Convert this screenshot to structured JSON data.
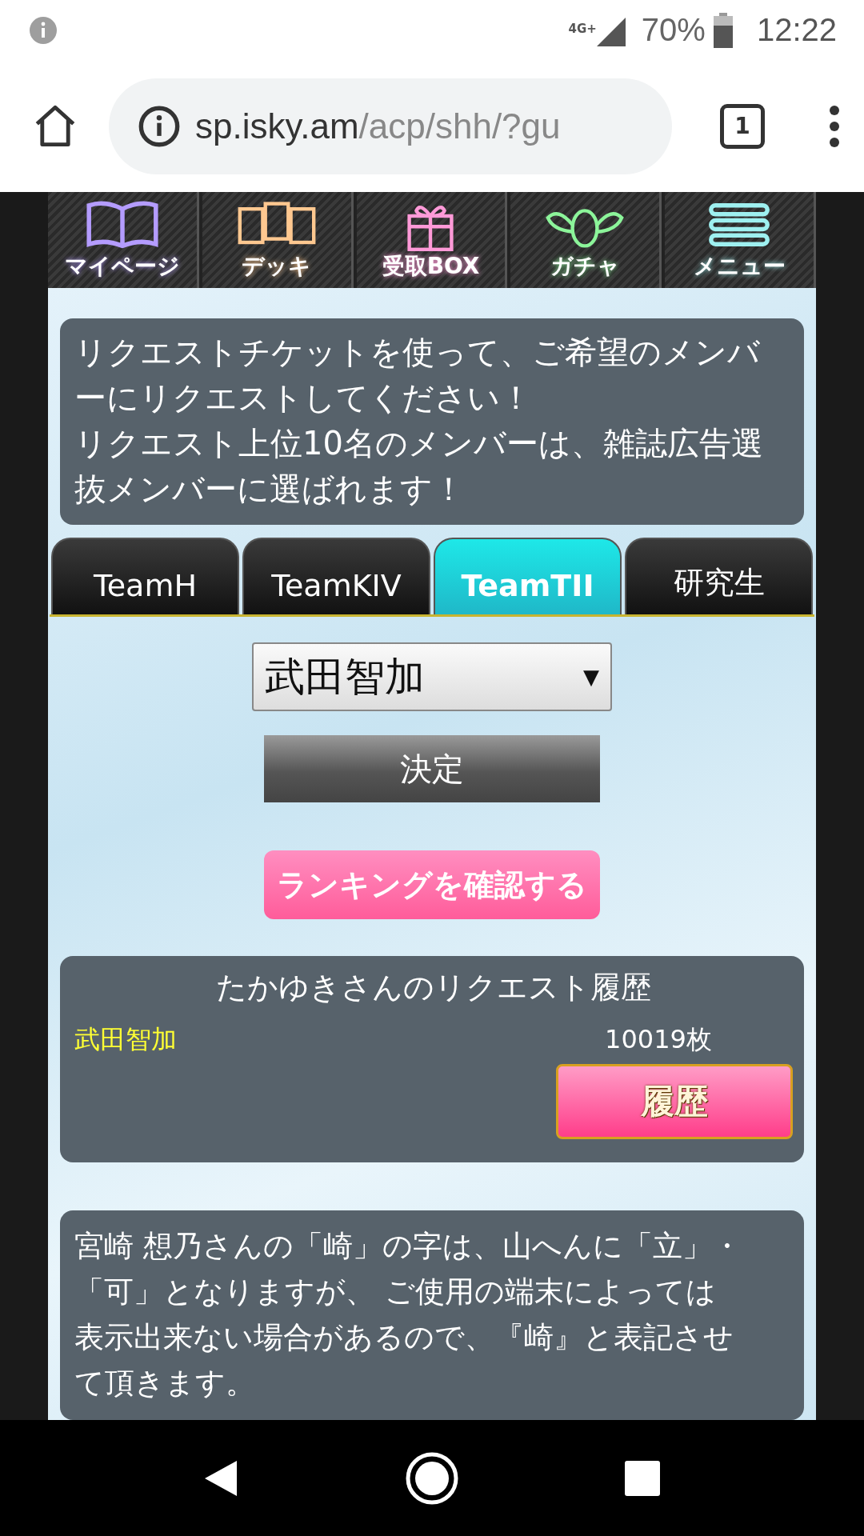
{
  "status_bar": {
    "signal_label": "4G+",
    "battery": "70%",
    "time": "12:22"
  },
  "browser": {
    "url_host": "sp.isky.am",
    "url_path": "/acp/shh/?gu",
    "tab_count": "1"
  },
  "nav": [
    {
      "kind": "book",
      "label": "マイページ",
      "color": "#b49cff"
    },
    {
      "kind": "cards",
      "label": "デッキ",
      "color": "#ffc890"
    },
    {
      "kind": "gift",
      "label": "受取BOX",
      "color": "#ff9ad8"
    },
    {
      "kind": "wings",
      "label": "ガチャ",
      "color": "#8cf59a"
    },
    {
      "kind": "lines",
      "label": "メニュー",
      "color": "#9ef0f0"
    }
  ],
  "intro": [
    "リクエストチケットを使って、ご希望のメンバーにリクエストしてください！",
    "リクエスト上位10名のメンバーは、雑誌広告選抜メンバーに選ばれます！"
  ],
  "tabs": [
    {
      "label": "TeamH",
      "selected": false
    },
    {
      "label": "TeamKIV",
      "selected": false
    },
    {
      "label": "TeamTII",
      "selected": true
    },
    {
      "label": "研究生",
      "selected": false
    }
  ],
  "member_select": {
    "value": "武田智加",
    "arrow": "▼"
  },
  "decide_button": "決定",
  "ranking_button": "ランキングを確認する",
  "history": {
    "title": "たかゆきさんのリクエスト履歴",
    "rows": [
      {
        "member": "武田智加",
        "count": "10019枚",
        "button": "履歴"
      }
    ]
  },
  "note": "宮崎 想乃さんの「崎」の字は、山へんに「立」・「可」となりますが、 ご使用の端末によっては表示出来ない場合があるので、『崎』と表記させて頂きます。"
}
